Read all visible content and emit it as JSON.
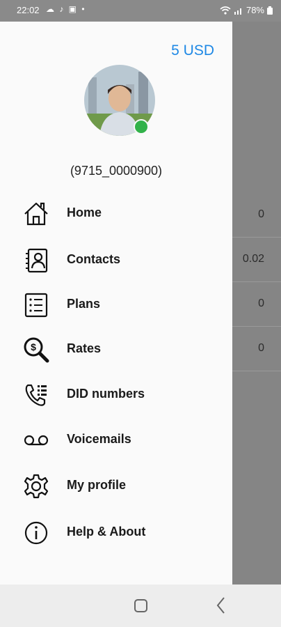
{
  "status_bar": {
    "time": "22:02",
    "left_icons": "☁ ♪ ▣ •",
    "battery": "78%"
  },
  "drawer": {
    "balance": "5 USD",
    "phone": "(9715_0000900)",
    "online_color": "#32b24a",
    "accent_color": "#1e88e5",
    "menu": [
      {
        "label": "Home",
        "icon": "home-icon"
      },
      {
        "label": "Contacts",
        "icon": "contacts-icon"
      },
      {
        "label": "Plans",
        "icon": "plans-icon"
      },
      {
        "label": "Rates",
        "icon": "rates-icon"
      },
      {
        "label": "DID numbers",
        "icon": "did-numbers-icon"
      },
      {
        "label": "Voicemails",
        "icon": "voicemail-icon"
      },
      {
        "label": "My profile",
        "icon": "gear-icon"
      },
      {
        "label": "Help & About",
        "icon": "info-icon"
      }
    ]
  },
  "background": {
    "values": [
      "0",
      "0.02",
      "0",
      "0"
    ]
  }
}
